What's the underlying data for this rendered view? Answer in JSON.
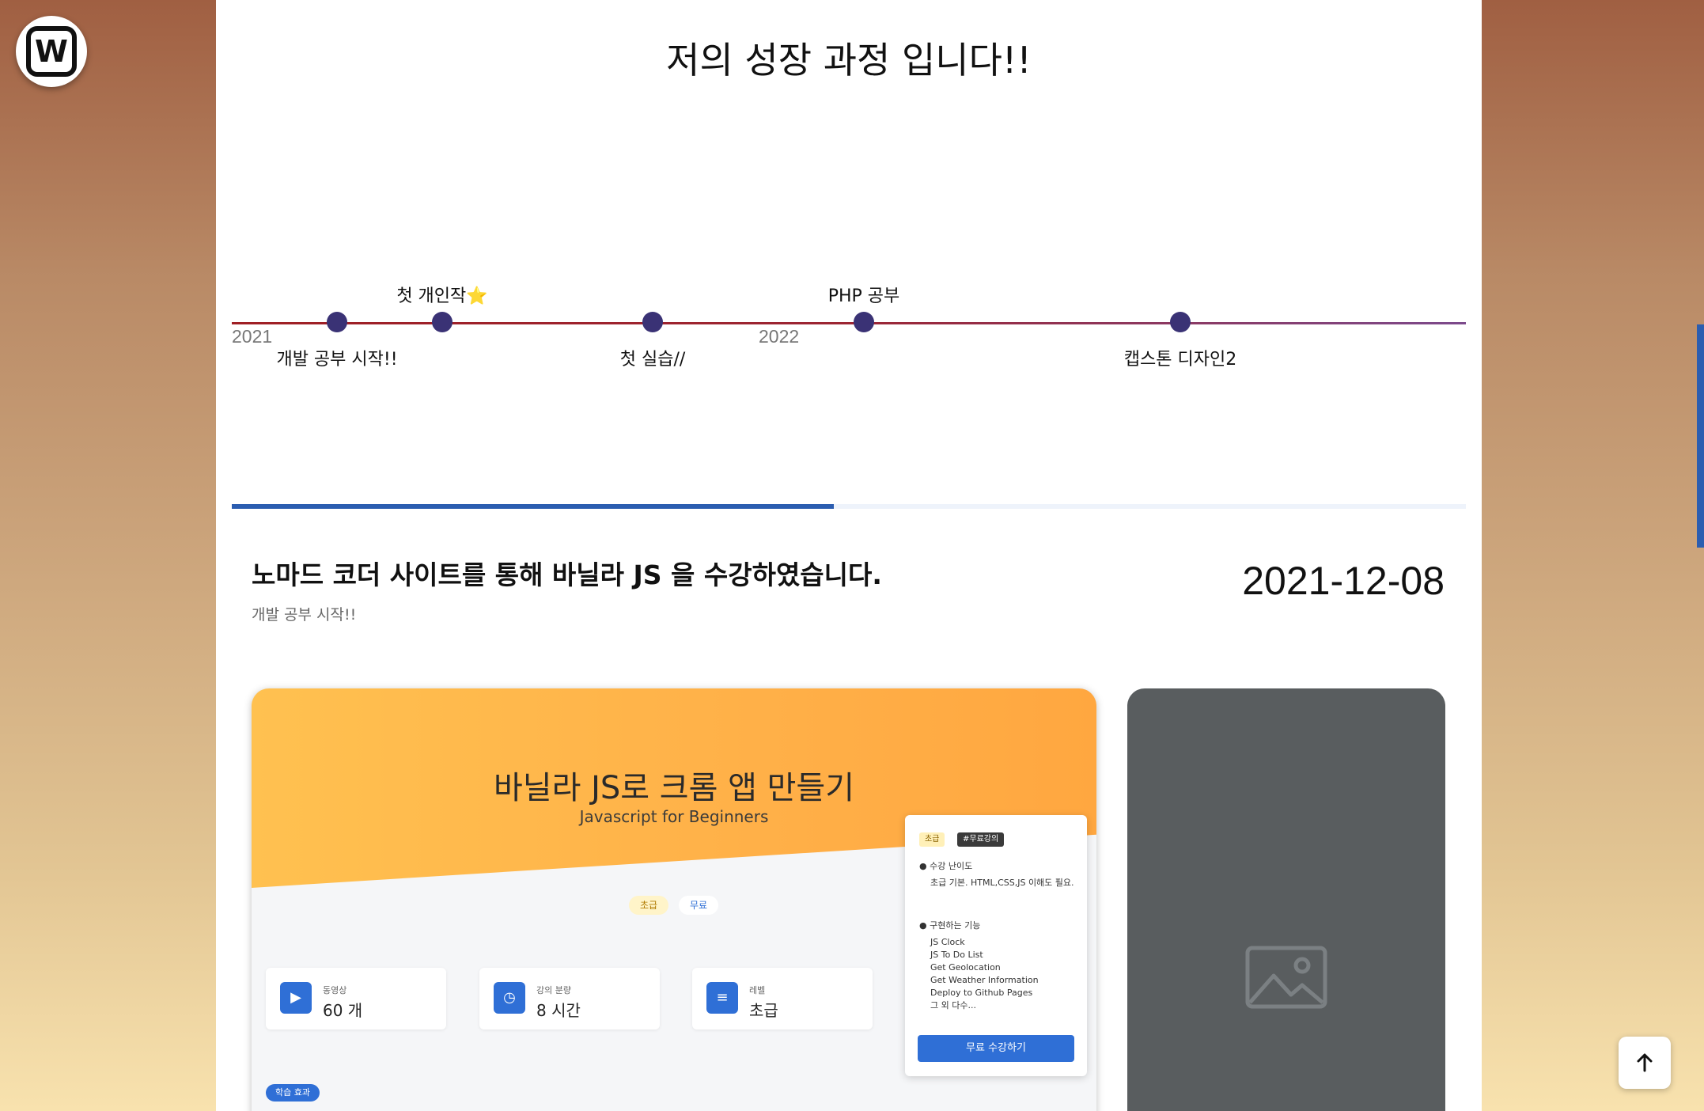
{
  "logo": {
    "letter": "W"
  },
  "page": {
    "title": "저의 성장 과정 입니다!!"
  },
  "timeline": {
    "years": [
      "2021",
      "2022"
    ],
    "labels_above": [
      "첫 개인작⭐",
      "PHP 공부"
    ],
    "labels_below": [
      "개발 공부 시작!!",
      "첫 실습//",
      "캡스톤 디자인2"
    ]
  },
  "progress": {
    "fraction": 0.488
  },
  "post": {
    "title": "노마드 코더 사이트를 통해 바닐라 JS 을 수강하였습니다.",
    "subtitle": "개발 공부 시작!!",
    "date": "2021-12-08"
  },
  "course": {
    "title": "바닐라 JS로 크롬 앱 만들기",
    "subtitle": "Javascript for Beginners",
    "pills": [
      "초급",
      "무료"
    ],
    "stats": [
      {
        "label": "동영상",
        "value": "60 개",
        "icon": "play-icon"
      },
      {
        "label": "강의 분량",
        "value": "8 시간",
        "icon": "clock-icon"
      },
      {
        "label": "레벨",
        "value": "초급",
        "icon": "sliders-icon"
      }
    ],
    "learn_badge": "학습 효과",
    "side": {
      "tag_level": "초급",
      "tag_free": "#무료강의",
      "difficulty_head": "수강 난이도",
      "difficulty_text": "초급 기본. HTML,CSS,JS 이해도 필요.",
      "features_head": "구현하는 기능",
      "features": [
        "JS Clock",
        "JS To Do List",
        "Get Geolocation",
        "Get Weather Information",
        "Deploy to Github Pages",
        "그 외 다수..."
      ],
      "button": "무료 수강하기"
    }
  },
  "colors": {
    "accent": "#2b5db0",
    "dot": "#3a3275",
    "line": "#9f1f24"
  }
}
